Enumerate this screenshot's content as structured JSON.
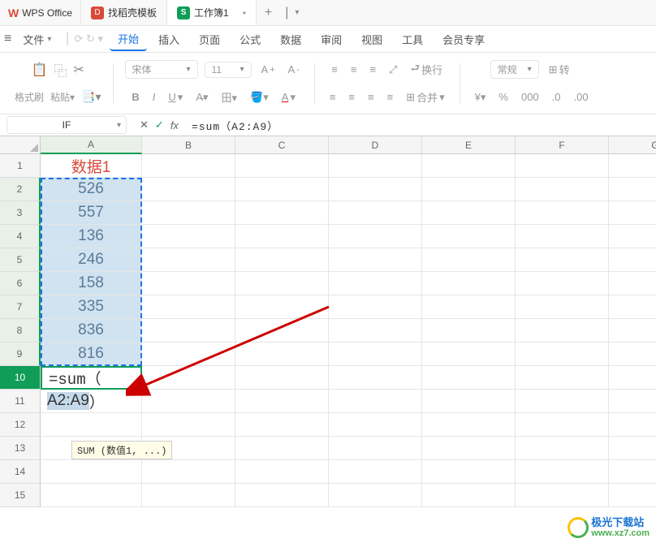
{
  "app": {
    "name": "WPS Office"
  },
  "tabs": [
    {
      "label": "找稻壳模板"
    },
    {
      "label": "工作簿1",
      "dirty": "•"
    }
  ],
  "add_tab": "+",
  "menu": {
    "file": "文件",
    "items": [
      "开始",
      "插入",
      "页面",
      "公式",
      "数据",
      "审阅",
      "视图",
      "工具",
      "会员专享"
    ]
  },
  "ribbon": {
    "format_painter": "格式刷",
    "paste": "粘贴",
    "font": "宋体",
    "size": "11",
    "wrap": "换行",
    "merge": "合并",
    "normal": "常规",
    "transpose": "转"
  },
  "name_box": "IF",
  "formula_bar": "=sum（A2:A9）",
  "formula_fx": "fx",
  "columns": [
    "A",
    "B",
    "C",
    "D",
    "E",
    "F",
    "G"
  ],
  "rows": [
    "1",
    "2",
    "3",
    "4",
    "5",
    "6",
    "7",
    "8",
    "9",
    "10",
    "11",
    "12",
    "13",
    "14",
    "15"
  ],
  "sheet": {
    "a1": "数据1",
    "data": [
      "526",
      "557",
      "136",
      "246",
      "158",
      "335",
      "836",
      "816"
    ],
    "a10": "=sum（",
    "a11_ref": "A2:A9",
    "a11_close": "）"
  },
  "tooltip": "SUM (数值1, ...)",
  "watermark": {
    "cn": "极光下载站",
    "en": "www.xz7.com"
  }
}
